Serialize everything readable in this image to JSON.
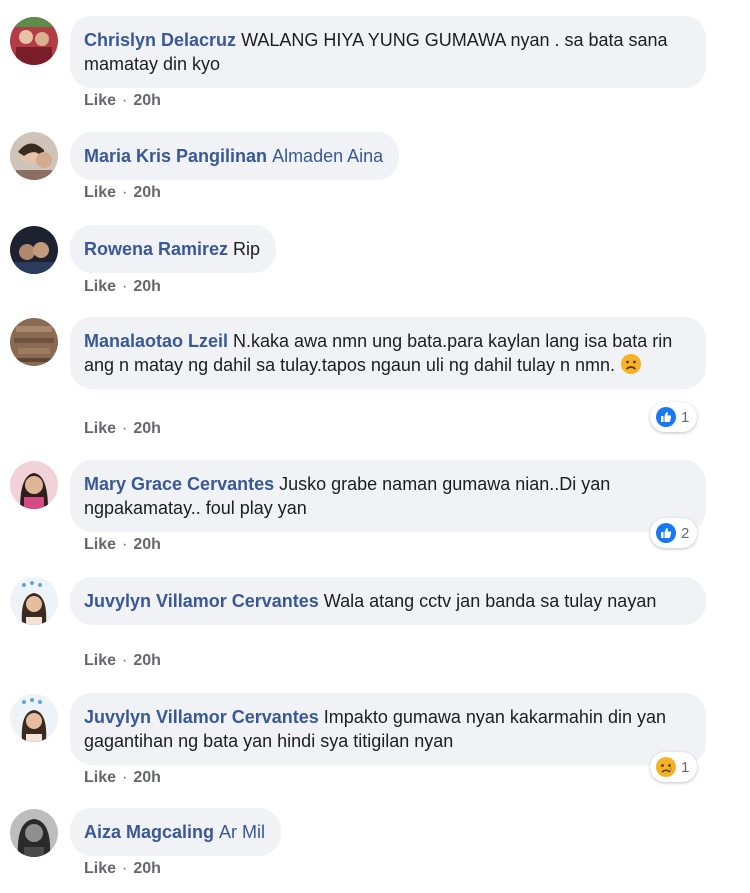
{
  "comments": [
    {
      "author": "Chrislyn Delacruz",
      "text": "WALANG HIYA YUNG GUMAWA nyan . sa bata sana mamatay din kyo",
      "like": "Like",
      "time": "20h"
    },
    {
      "author": "Maria Kris Pangilinan",
      "tag": "Almaden Aina",
      "like": "Like",
      "time": "20h"
    },
    {
      "author": "Rowena Ramirez",
      "text": "Rip",
      "like": "Like",
      "time": "20h"
    },
    {
      "author": "Manalaotao Lzeil",
      "text": "N.kaka awa nmn ung bata.para kaylan lang isa bata rin ang n matay ng dahil sa tulay.tapos ngaun uli ng dahil tulay n nmn.",
      "emoji": "sad-face",
      "like": "Like",
      "time": "20h",
      "reaction": {
        "icon": "like-reaction-icon",
        "count": "1"
      }
    },
    {
      "author": "Mary Grace Cervantes",
      "text": "Jusko grabe naman gumawa nian..Di yan ngpakamatay.. foul play yan",
      "like": "Like",
      "time": "20h",
      "reaction": {
        "icon": "like-reaction-icon",
        "count": "2"
      }
    },
    {
      "author": "Juvylyn Villamor Cervantes",
      "text": "Wala atang cctv jan banda sa tulay nayan",
      "like": "Like",
      "time": "20h"
    },
    {
      "author": "Juvylyn Villamor Cervantes",
      "text": "Impakto gumawa nyan kakarmahin din yan gagantihan ng bata yan hindi sya titigilan nyan",
      "like": "Like",
      "time": "20h",
      "reaction": {
        "icon": "sad-reaction-icon",
        "count": "1"
      }
    },
    {
      "author": "Aiza Magcaling",
      "tag": "Ar Mil",
      "like": "Like",
      "time": "20h"
    }
  ],
  "colors": {
    "author": "#385898",
    "bubble": "#f0f2f5",
    "meta": "#65676b",
    "like_blue": "#1877f2",
    "sad_yellow": "#f7b125"
  },
  "meta_separator": "·"
}
